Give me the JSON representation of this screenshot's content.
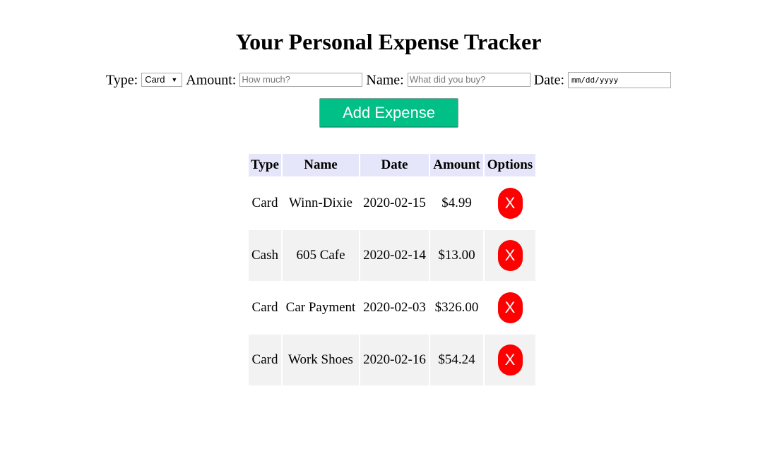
{
  "page": {
    "title": "Your Personal Expense Tracker"
  },
  "form": {
    "type_label": "Type:",
    "type_value": "Card",
    "amount_label": "Amount:",
    "amount_placeholder": "How much?",
    "name_label": "Name:",
    "name_placeholder": "What did you buy?",
    "date_label": "Date:",
    "date_placeholder": "mm/dd/yyyy",
    "add_button": "Add Expense"
  },
  "table": {
    "headers": [
      "Type",
      "Name",
      "Date",
      "Amount",
      "Options"
    ],
    "rows": [
      {
        "type": "Card",
        "name": "Winn-Dixie",
        "date": "2020-02-15",
        "amount": "$4.99",
        "delete": "X"
      },
      {
        "type": "Cash",
        "name": "605 Cafe",
        "date": "2020-02-14",
        "amount": "$13.00",
        "delete": "X"
      },
      {
        "type": "Card",
        "name": "Car Payment",
        "date": "2020-02-03",
        "amount": "$326.00",
        "delete": "X"
      },
      {
        "type": "Card",
        "name": "Work Shoes",
        "date": "2020-02-16",
        "amount": "$54.24",
        "delete": "X"
      }
    ]
  },
  "colors": {
    "add_button": "#00bf87",
    "delete_button": "#ff0000",
    "header_background": "#e6e6fa",
    "alt_row_background": "#f2f2f2"
  },
  "icons": {
    "select_arrow": "triangle-down-icon"
  }
}
